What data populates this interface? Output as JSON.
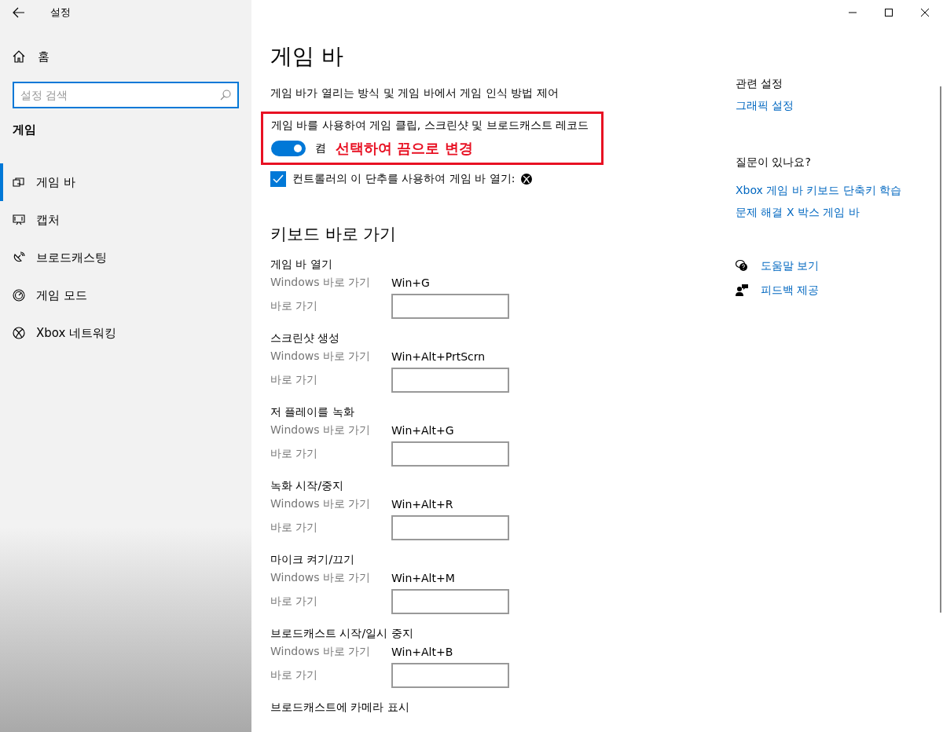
{
  "window": {
    "title": "설정"
  },
  "sidebar": {
    "home": "홈",
    "search": {
      "placeholder": "설정 검색"
    },
    "section": "게임",
    "items": [
      {
        "label": "게임 바",
        "selected": true
      },
      {
        "label": "캡처",
        "selected": false
      },
      {
        "label": "브로드캐스팅",
        "selected": false
      },
      {
        "label": "게임 모드",
        "selected": false
      },
      {
        "label": "Xbox 네트워킹",
        "selected": false
      }
    ]
  },
  "main": {
    "title": "게임 바",
    "description": "게임 바가 열리는 방식 및 게임 바에서 게임 인식 방법 제어",
    "setting": {
      "label": "게임 바를 사용하여 게임 클립, 스크린샷 및 브로드캐스트 레코드",
      "on": true,
      "state_text": "켬"
    },
    "annotation": {
      "text": "선택하여 끔으로 변경"
    },
    "checkbox": {
      "label": "컨트롤러의 이 단추를 사용하여 게임 바 열기:",
      "checked": true
    },
    "shortcuts_heading": "키보드 바로 가기",
    "shortcuts": [
      {
        "name": "게임 바 열기",
        "windows_label": "Windows 바로 가기",
        "keys": "Win+G",
        "custom_label": "바로 가기"
      },
      {
        "name": "스크린샷 생성",
        "windows_label": "Windows 바로 가기",
        "keys": "Win+Alt+PrtScrn",
        "custom_label": "바로 가기"
      },
      {
        "name": "저 플레이를 녹화",
        "windows_label": "Windows 바로 가기",
        "keys": "Win+Alt+G",
        "custom_label": "바로 가기"
      },
      {
        "name": "녹화 시작/중지",
        "windows_label": "Windows 바로 가기",
        "keys": "Win+Alt+R",
        "custom_label": "바로 가기"
      },
      {
        "name": "마이크 켜기/끄기",
        "windows_label": "Windows 바로 가기",
        "keys": "Win+Alt+M",
        "custom_label": "바로 가기"
      },
      {
        "name": "브로드캐스트 시작/일시 중지",
        "windows_label": "Windows 바로 가기",
        "keys": "Win+Alt+B",
        "custom_label": "바로 가기"
      },
      {
        "name": "브로드캐스트에 카메라 표시"
      }
    ]
  },
  "aside": {
    "related_heading": "관련 설정",
    "related_links": [
      "그래픽 설정"
    ],
    "help_heading": "질문이 있나요?",
    "help_links": [
      "Xbox 게임 바 키보드 단축키 학습",
      "문제 해결 X 박스 게임 바"
    ],
    "support": [
      "도움말 보기",
      "피드백 제공"
    ]
  }
}
